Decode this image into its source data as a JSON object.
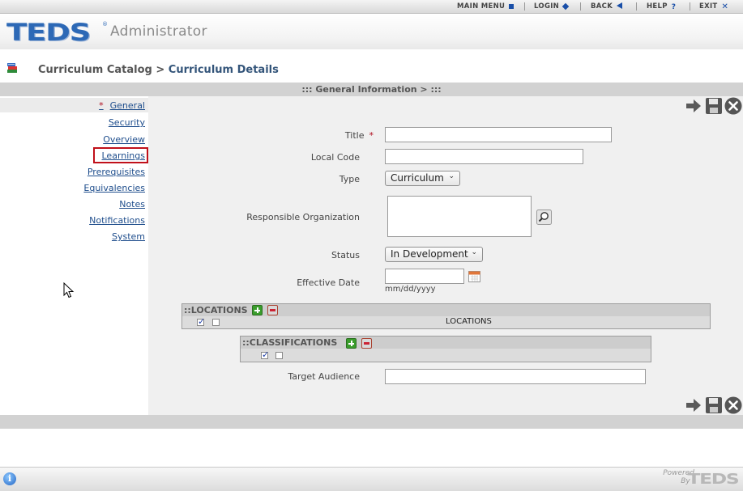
{
  "topnav": {
    "main_menu": "MAIN MENU",
    "login": "LOGIN",
    "back": "BACK",
    "help": "HELP",
    "exit": "EXIT"
  },
  "header": {
    "logo": "TEDS",
    "app_name": "Administrator"
  },
  "breadcrumb": {
    "parent": "Curriculum Catalog",
    "separator": ">",
    "current": "Curriculum Details"
  },
  "section": {
    "title": "::: General Information > :::"
  },
  "sidebar": {
    "required_marker": "*",
    "items": [
      {
        "label": "General"
      },
      {
        "label": "Security"
      },
      {
        "label": "Overview"
      },
      {
        "label": "Learnings"
      },
      {
        "label": "Prerequisites"
      },
      {
        "label": "Equivalencies"
      },
      {
        "label": "Notes"
      },
      {
        "label": "Notifications"
      },
      {
        "label": "System"
      }
    ]
  },
  "form": {
    "title_label": "Title",
    "required_marker": "*",
    "title_value": "",
    "local_code_label": "Local Code",
    "local_code_value": "",
    "type_label": "Type",
    "type_value": "Curriculum",
    "resp_org_label": "Responsible Organization",
    "resp_org_value": "",
    "status_label": "Status",
    "status_value": "In Development",
    "effective_date_label": "Effective Date",
    "effective_date_value": "",
    "date_format_hint": "mm/dd/yyyy",
    "target_audience_label": "Target Audience",
    "target_audience_value": ""
  },
  "locations_panel": {
    "title": "::LOCATIONS",
    "column_header": "LOCATIONS"
  },
  "classifications_panel": {
    "title": "::CLASSIFICATIONS"
  },
  "footer": {
    "powered_line1": "Powered",
    "powered_line2": "By",
    "logo": "TEDS"
  },
  "colors": {
    "brand_blue": "#2d69b6",
    "link_blue": "#1e4d8c",
    "required_red": "#b01020",
    "highlight_red": "#c0101a",
    "section_gray": "#d2d2d2"
  },
  "icons": [
    "stop-icon",
    "login-icon",
    "back-icon",
    "help-icon",
    "exit-icon",
    "books-icon",
    "go-arrow-icon",
    "save-disk-icon",
    "close-x-icon",
    "magnifier-icon",
    "calendar-icon",
    "add-icon",
    "remove-icon",
    "info-icon",
    "mouse-cursor-icon"
  ]
}
